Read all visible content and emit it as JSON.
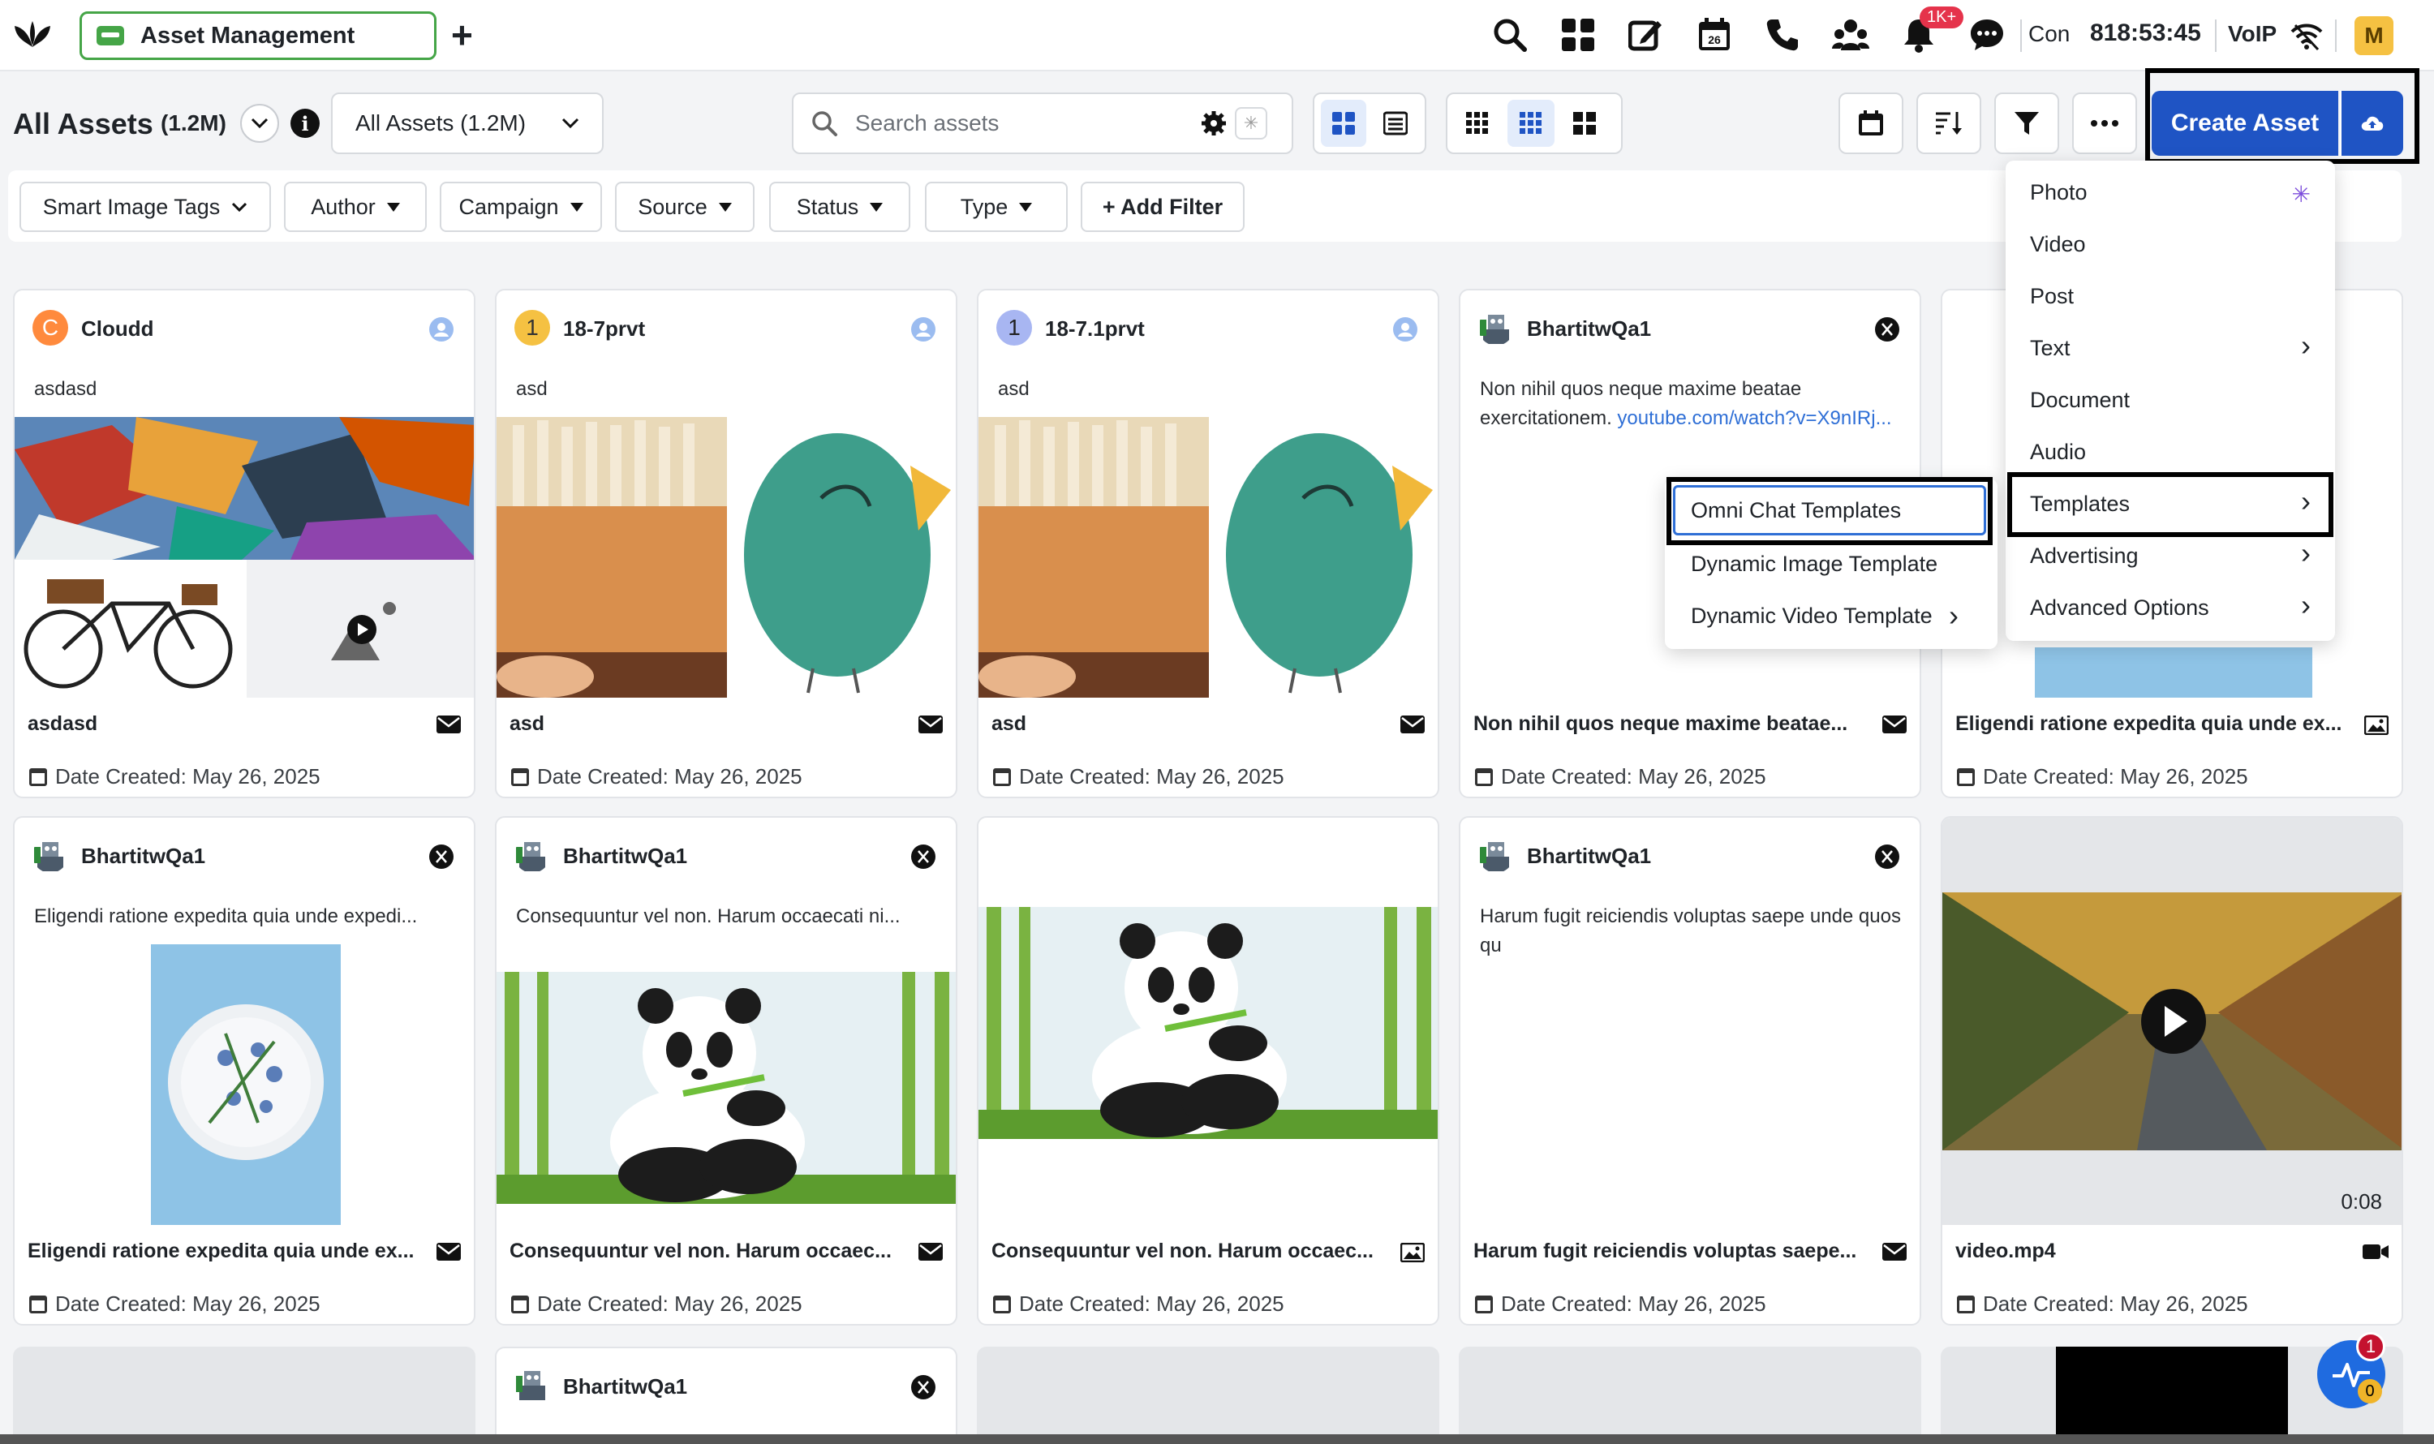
{
  "topbar": {
    "app_tab": "Asset Management",
    "add_tab": "+",
    "notif_badge": "1K+",
    "con": "Con",
    "timer": "818:53:45",
    "voip": "VoIP",
    "avatar": "M",
    "calendar_day": "26",
    "icons": [
      "search-icon",
      "apps-grid-icon",
      "compose-icon",
      "calendar-icon",
      "phone-icon",
      "team-icon",
      "bell-icon",
      "chat-icon",
      "wifi-icon"
    ]
  },
  "header": {
    "title": "All Assets",
    "count": "(1.2M)",
    "info": "i",
    "view_select": "All Assets (1.2M)",
    "search_placeholder": "Search assets",
    "create_label": "Create Asset"
  },
  "filters": [
    "Smart Image Tags",
    "Author",
    "Campaign",
    "Source",
    "Status",
    "Type"
  ],
  "add_filter": "+ Add Filter",
  "create_menu": {
    "items": [
      {
        "label": "Photo"
      },
      {
        "label": "Video"
      },
      {
        "label": "Post"
      },
      {
        "label": "Text"
      },
      {
        "label": "Document"
      },
      {
        "label": "Audio"
      },
      {
        "label": "Templates"
      },
      {
        "label": "Advertising"
      },
      {
        "label": "Advanced Options"
      }
    ]
  },
  "templates_menu": {
    "items": [
      "Omni Chat Templates",
      "Dynamic Image Template",
      "Dynamic Video Template"
    ]
  },
  "cards": [
    {
      "author": "Cloudd",
      "avatar": "C",
      "desc": "asdasd",
      "title": "asdasd",
      "date": "Date Created: May 26, 2025"
    },
    {
      "author": "18-7prvt",
      "avatar": "1",
      "desc": "asd",
      "title": "asd",
      "date": "Date Created: May 26, 2025"
    },
    {
      "author": "18-7.1prvt",
      "avatar": "1",
      "desc": "asd",
      "title": "asd",
      "date": "Date Created: May 26, 2025"
    },
    {
      "author": "BhartitwQa1",
      "desc": "Non nihil quos neque maxime beatae exercitationem. ",
      "link": "youtube.com/watch?v=X9nIRj...",
      "title": "Non nihil quos neque maxime beatae...",
      "date": "Date Created: May 26, 2025"
    },
    {
      "title": "Eligendi ratione expedita quia unde ex...",
      "date": "Date Created: May 26, 2025"
    },
    {
      "author": "BhartitwQa1",
      "desc": "Eligendi ratione expedita quia unde expedi...",
      "title": "Eligendi ratione expedita quia unde ex...",
      "date": "Date Created: May 26, 2025"
    },
    {
      "author": "BhartitwQa1",
      "desc": "Consequuntur vel non. Harum occaecati ni...",
      "title": "Consequuntur vel non. Harum occaec...",
      "date": "Date Created: May 26, 2025"
    },
    {
      "title": "Consequuntur vel non. Harum occaec...",
      "date": "Date Created: May 26, 2025"
    },
    {
      "author": "BhartitwQa1",
      "desc": "Harum fugit reiciendis voluptas saepe unde quos qu",
      "title": "Harum fugit reiciendis voluptas saepe...",
      "date": "Date Created: May 26, 2025"
    },
    {
      "title": "video.mp4",
      "duration": "0:08",
      "date": "Date Created: May 26, 2025"
    },
    {
      "author": "BhartitwQa1"
    }
  ],
  "float": {
    "badge_top": "1",
    "badge_bottom": "0"
  }
}
